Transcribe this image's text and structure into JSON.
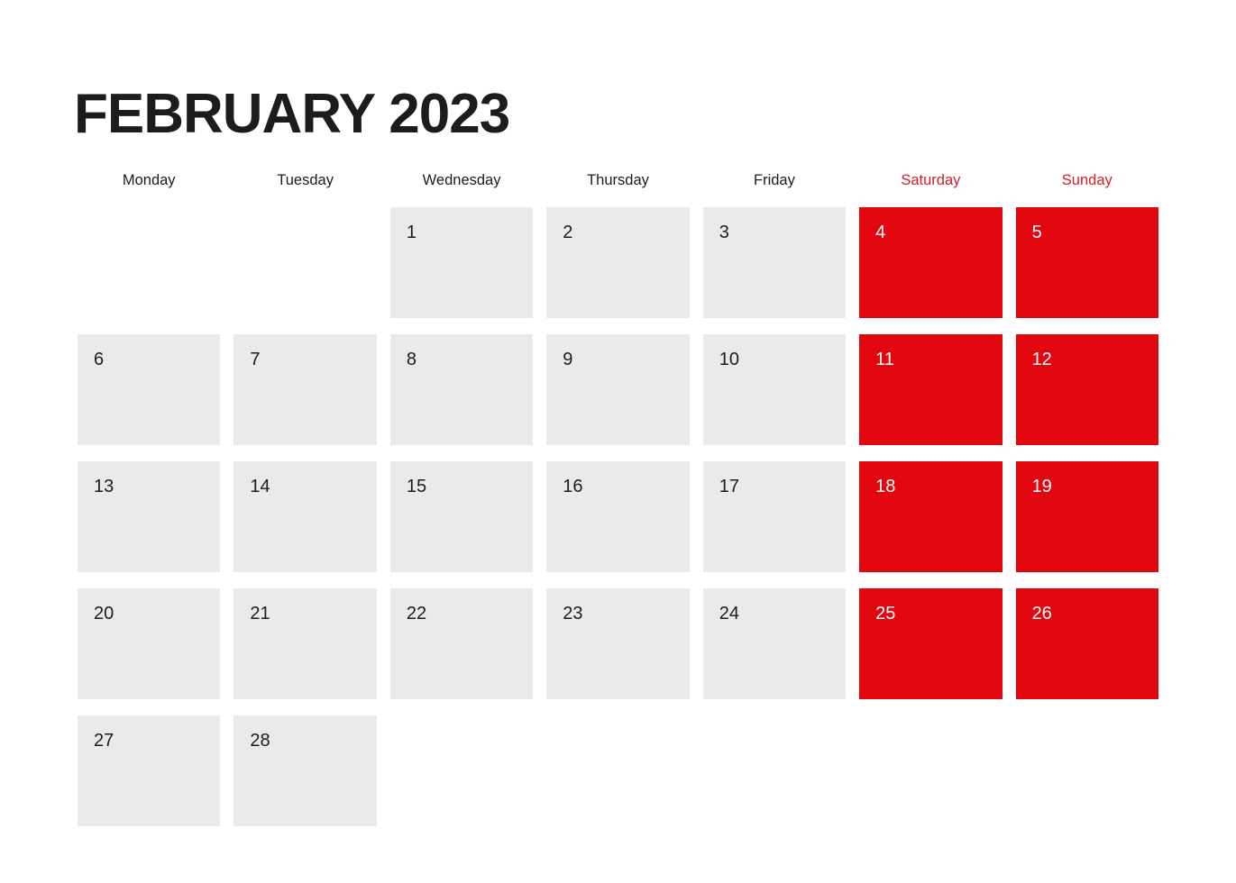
{
  "title": "FEBRUARY 2023",
  "month": "February",
  "year": "2023",
  "colors": {
    "weekend_cell": "#e2060f",
    "weekday_cell": "#eaeaea",
    "weekend_header_text": "#cf2027",
    "text": "#1c1c1c",
    "background": "#ffffff"
  },
  "weekdays": [
    {
      "label": "Monday",
      "weekend": false
    },
    {
      "label": "Tuesday",
      "weekend": false
    },
    {
      "label": "Wednesday",
      "weekend": false
    },
    {
      "label": "Thursday",
      "weekend": false
    },
    {
      "label": "Friday",
      "weekend": false
    },
    {
      "label": "Saturday",
      "weekend": true
    },
    {
      "label": "Sunday",
      "weekend": true
    }
  ],
  "weeks": [
    [
      {
        "day": "",
        "empty": true,
        "weekend": false
      },
      {
        "day": "",
        "empty": true,
        "weekend": false
      },
      {
        "day": "1",
        "empty": false,
        "weekend": false
      },
      {
        "day": "2",
        "empty": false,
        "weekend": false
      },
      {
        "day": "3",
        "empty": false,
        "weekend": false
      },
      {
        "day": "4",
        "empty": false,
        "weekend": true
      },
      {
        "day": "5",
        "empty": false,
        "weekend": true
      }
    ],
    [
      {
        "day": "6",
        "empty": false,
        "weekend": false
      },
      {
        "day": "7",
        "empty": false,
        "weekend": false
      },
      {
        "day": "8",
        "empty": false,
        "weekend": false
      },
      {
        "day": "9",
        "empty": false,
        "weekend": false
      },
      {
        "day": "10",
        "empty": false,
        "weekend": false
      },
      {
        "day": "11",
        "empty": false,
        "weekend": true
      },
      {
        "day": "12",
        "empty": false,
        "weekend": true
      }
    ],
    [
      {
        "day": "13",
        "empty": false,
        "weekend": false
      },
      {
        "day": "14",
        "empty": false,
        "weekend": false
      },
      {
        "day": "15",
        "empty": false,
        "weekend": false
      },
      {
        "day": "16",
        "empty": false,
        "weekend": false
      },
      {
        "day": "17",
        "empty": false,
        "weekend": false
      },
      {
        "day": "18",
        "empty": false,
        "weekend": true
      },
      {
        "day": "19",
        "empty": false,
        "weekend": true
      }
    ],
    [
      {
        "day": "20",
        "empty": false,
        "weekend": false
      },
      {
        "day": "21",
        "empty": false,
        "weekend": false
      },
      {
        "day": "22",
        "empty": false,
        "weekend": false
      },
      {
        "day": "23",
        "empty": false,
        "weekend": false
      },
      {
        "day": "24",
        "empty": false,
        "weekend": false
      },
      {
        "day": "25",
        "empty": false,
        "weekend": true
      },
      {
        "day": "26",
        "empty": false,
        "weekend": true
      }
    ],
    [
      {
        "day": "27",
        "empty": false,
        "weekend": false
      },
      {
        "day": "28",
        "empty": false,
        "weekend": false
      },
      {
        "day": "",
        "empty": true,
        "weekend": false
      },
      {
        "day": "",
        "empty": true,
        "weekend": false
      },
      {
        "day": "",
        "empty": true,
        "weekend": false
      },
      {
        "day": "",
        "empty": true,
        "weekend": true
      },
      {
        "day": "",
        "empty": true,
        "weekend": true
      }
    ]
  ]
}
